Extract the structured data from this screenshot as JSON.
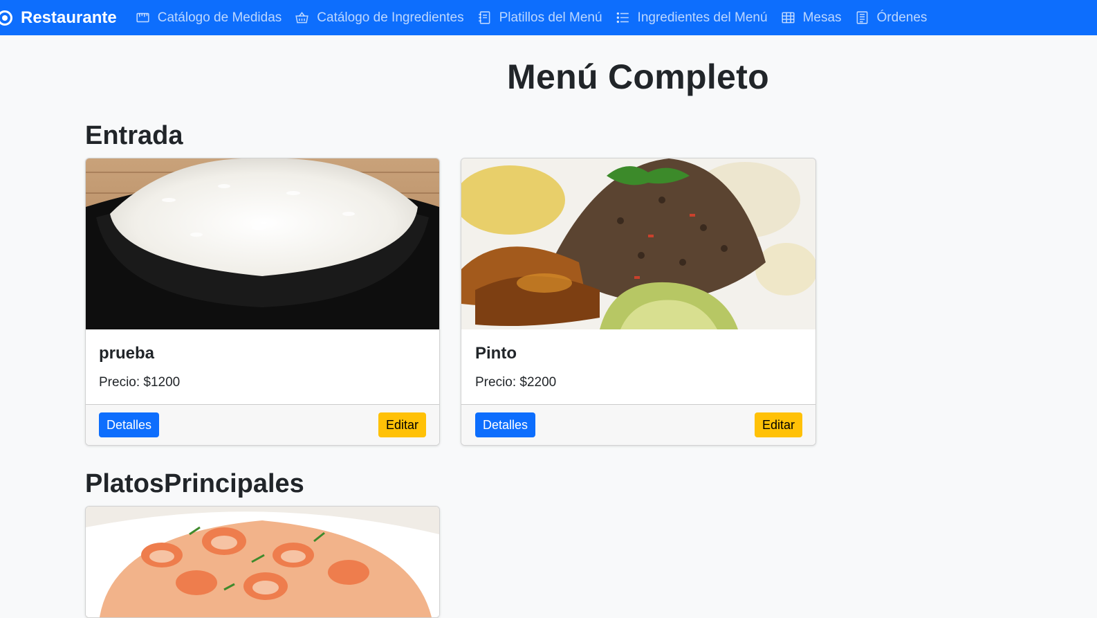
{
  "navbar": {
    "brand": "Restaurante",
    "items": [
      {
        "label": "Catálogo de Medidas",
        "icon": "ruler-icon"
      },
      {
        "label": "Catálogo de Ingredientes",
        "icon": "basket-icon"
      },
      {
        "label": "Platillos del Menú",
        "icon": "journal-icon"
      },
      {
        "label": "Ingredientes del Menú",
        "icon": "list-icon"
      },
      {
        "label": "Mesas",
        "icon": "table-icon"
      },
      {
        "label": "Órdenes",
        "icon": "receipt-icon"
      }
    ],
    "color": "#0d6efd"
  },
  "page": {
    "title": "Menú Completo"
  },
  "sections": [
    {
      "title": "Entrada",
      "cards": [
        {
          "name": "prueba",
          "price": "Precio: $1200",
          "details_label": "Detalles",
          "edit_label": "Editar",
          "image": "rice-bowl-photo"
        },
        {
          "name": "Pinto",
          "price": "Precio: $2200",
          "details_label": "Detalles",
          "edit_label": "Editar",
          "image": "gallo-pinto-photo"
        }
      ]
    },
    {
      "title": "PlatosPrincipales",
      "cards": [
        {
          "image": "shrimp-rice-photo"
        }
      ]
    }
  ],
  "colors": {
    "primary": "#0d6efd",
    "warning": "#ffc107",
    "background": "#f8f9fa"
  }
}
